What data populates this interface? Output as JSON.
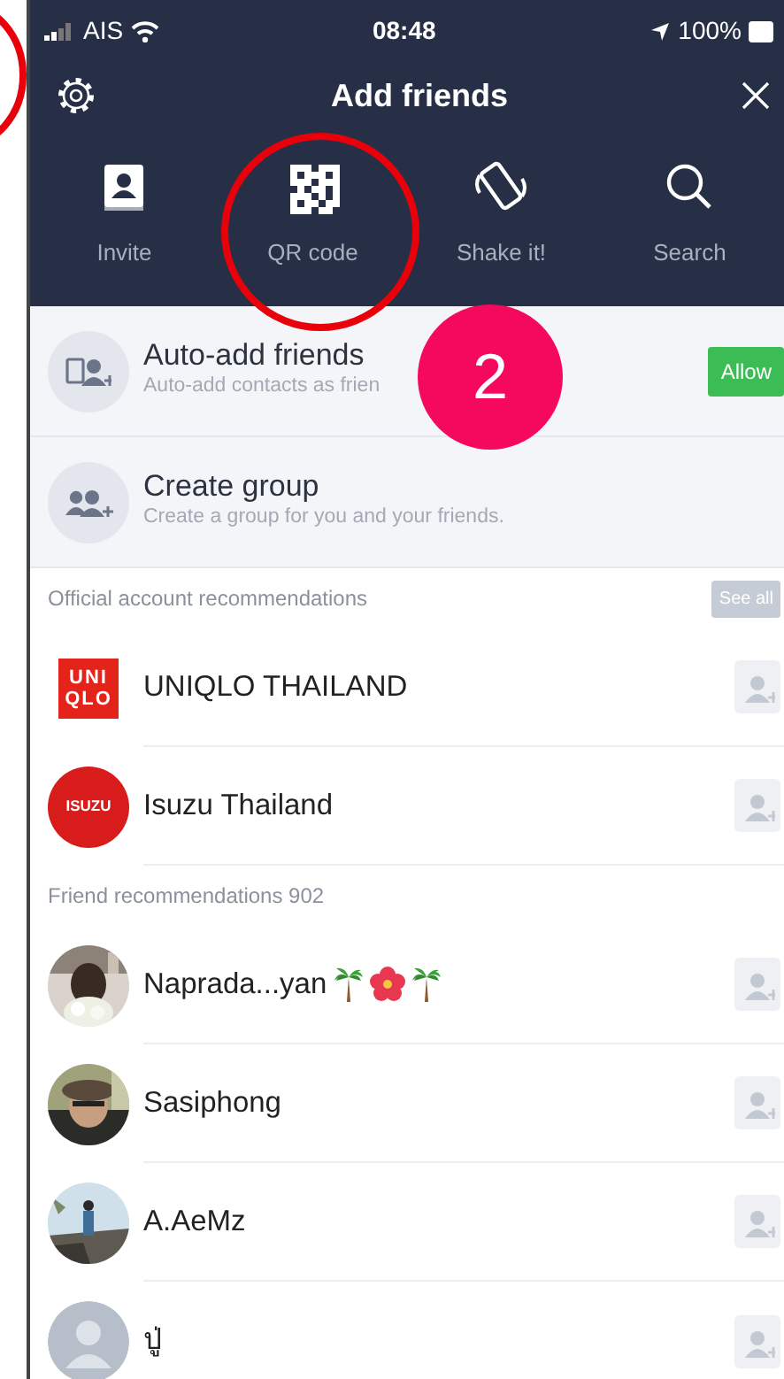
{
  "status_bar": {
    "carrier": "AIS",
    "time": "08:48",
    "battery": "100%"
  },
  "header": {
    "title": "Add friends"
  },
  "tabs": [
    {
      "label": "Invite",
      "kind": "invite"
    },
    {
      "label": "QR code",
      "kind": "qr"
    },
    {
      "label": "Shake it!",
      "kind": "shake"
    },
    {
      "label": "Search",
      "kind": "search"
    }
  ],
  "actions": [
    {
      "kind": "auto",
      "title": "Auto-add friends",
      "subtitle": "Auto-add contacts as frien",
      "button": "Allow"
    },
    {
      "kind": "group",
      "title": "Create group",
      "subtitle": "Create a group for you and your friends."
    }
  ],
  "sections": [
    {
      "heading": "Official account recommendations",
      "button": "See all",
      "items": [
        {
          "name": "UNIQLO THAILAND",
          "kind": "square-logo",
          "logo_text": [
            "UNI",
            "QLO"
          ]
        },
        {
          "name": "Isuzu Thailand",
          "kind": "round-logo",
          "logo_text": [
            "ISUZU"
          ]
        }
      ]
    },
    {
      "heading": "Friend recommendations 902",
      "items": [
        {
          "name": "Naprada...yan",
          "name_icons": [
            {
              "kind": "palm"
            },
            {
              "kind": "hibiscus"
            },
            {
              "kind": "palm"
            }
          ]
        },
        {
          "name": "Sasiphong"
        },
        {
          "name": "A.AeMz"
        },
        {
          "name": "ปู่",
          "kind": "default"
        }
      ]
    }
  ],
  "annotations": [
    {
      "kind": "ring"
    },
    {
      "kind": "ring"
    },
    {
      "kind": "number",
      "label": "2"
    }
  ]
}
